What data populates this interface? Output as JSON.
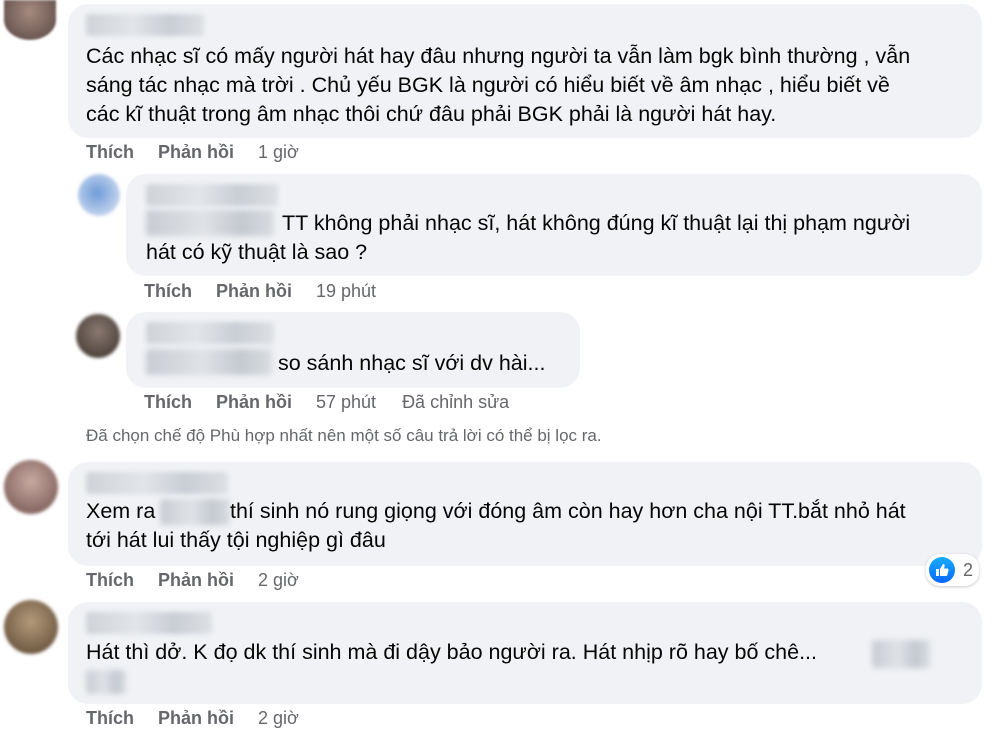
{
  "actions": {
    "like": "Thích",
    "reply": "Phản hồi"
  },
  "comments": [
    {
      "text_lines": [
        "Các nhạc sĩ có mấy người hát hay đâu nhưng người ta vẫn làm bgk bình thường , vẫn",
        "sáng tác nhạc mà trời . Chủ yếu BGK là người có hiểu biết về âm nhạc , hiểu biết về",
        "các kĩ thuật trong âm nhạc thôi chứ đâu phải BGK phải là người hát hay."
      ],
      "time": "1 giờ"
    },
    {
      "text_lines": [
        "TT không phải nhạc sĩ, hát không đúng kĩ thuật lại thị phạm người",
        "hát có kỹ thuật là sao ?"
      ],
      "time": "19 phút"
    },
    {
      "text_lines": [
        "so sánh nhạc sĩ với dv hài..."
      ],
      "time": "57 phút",
      "edited": "Đã chỉnh sửa"
    },
    {
      "text_prefix": "Xem ra",
      "text_line1_rest": "thí sinh nó rung giọng với đóng âm còn hay hơn cha nội TT.bắt nhỏ hát",
      "text_line2": "tới hát lui thấy tội nghiệp gì đâu",
      "time": "2 giờ",
      "reaction_count": "2",
      "reaction_icon": "like-icon"
    },
    {
      "text_lines": [
        "Hát thì dở. K đọ dk thí sinh mà đi dậy bảo người ra. Hát nhịp rõ hay bố chê..."
      ],
      "time": "2 giờ"
    }
  ],
  "filter_notice": "Đã chọn chế độ Phù hợp nhất nên một số câu trả lời có thể bị lọc ra.",
  "colors": {
    "bubble": "#f0f2f5",
    "secondary_text": "#65676b",
    "like_blue": "#0866ff"
  }
}
